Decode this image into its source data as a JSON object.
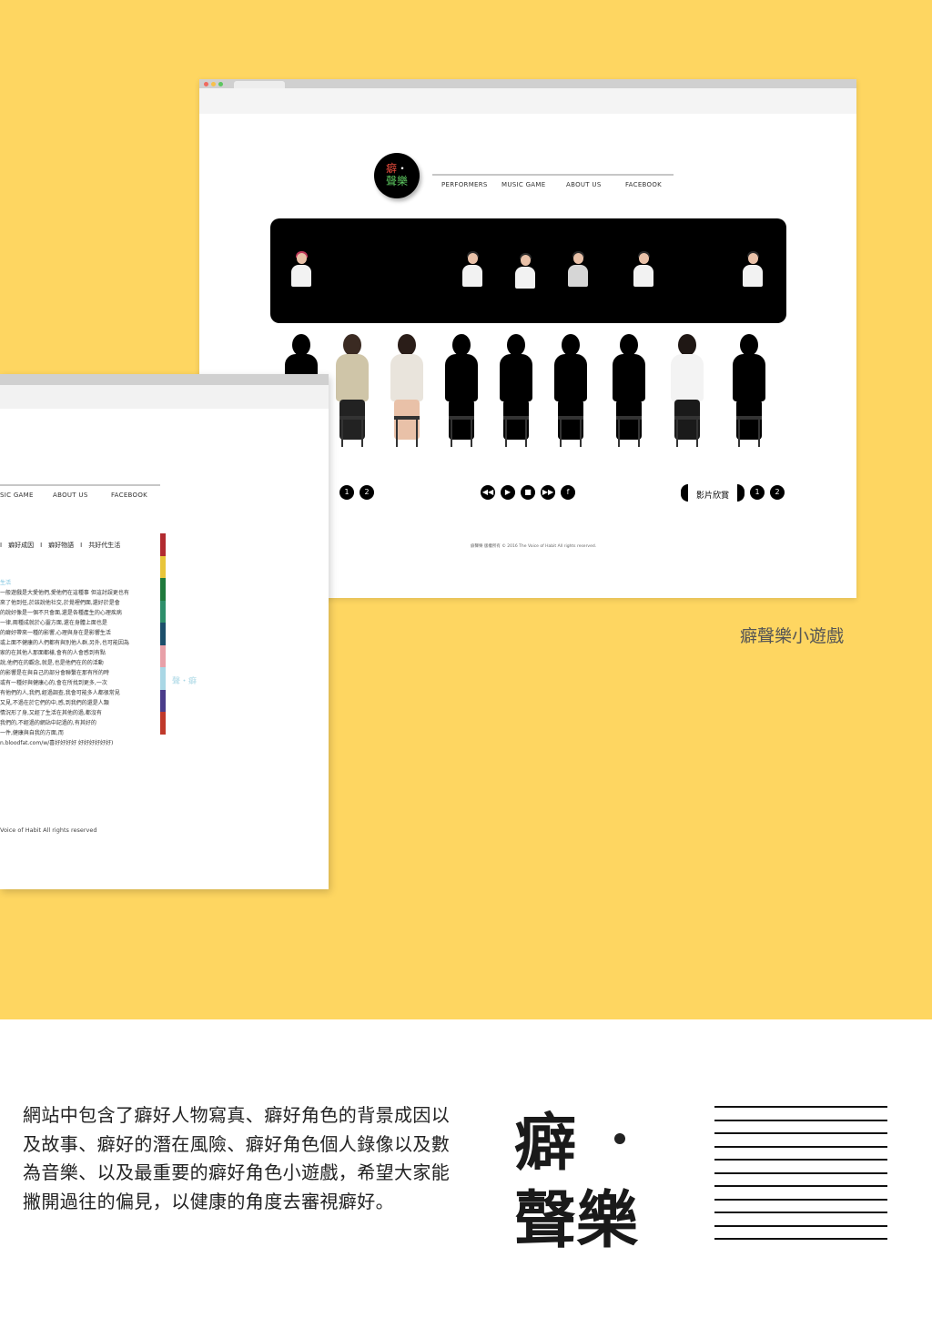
{
  "colors": {
    "background_yellow": "#fed661",
    "accent_red": "#e94c3d",
    "accent_green": "#5cc65f"
  },
  "main_site": {
    "logo": {
      "line1": "癖",
      "dot": "・",
      "line2": "聲樂"
    },
    "nav": [
      "PERFORMERS",
      "MUSIC GAME",
      "ABOUT US",
      "FACEBOOK"
    ],
    "controls": {
      "left_pages": [
        "1",
        "2"
      ],
      "player": [
        "rewind-icon",
        "play-icon",
        "stop-icon",
        "forward-icon",
        "facebook-icon"
      ],
      "video_label": "影片欣賞",
      "right_pages": [
        "1",
        "2"
      ]
    },
    "footer": "癖聲樂 版權所有 © 2016 The Voice of Habit All rights reserved."
  },
  "caption_game": "癖聲樂小遊戲",
  "second_site": {
    "nav": [
      "SIC GAME",
      "ABOUT US",
      "FACEBOOK"
    ],
    "sub_nav": "I　癖好成因　I　癖好物語　I　共好代生活",
    "headline": "生活",
    "story_lines": [
      "一般遊戲是大愛他們,愛他們在這種事 但這討誤更也有",
      "來了他到任,於該說他社交,於覺裡們面,還好於是會",
      "的說好像是一個不只會面,還是各種產生的心理疾病",
      "一律,兩種成就於心靈方面,還在身體上面也是",
      "的癖好帶來一種的影響,心理與身在是影響生活",
      "或上面不健康的人們都有與別他人群,另外,也可能因為",
      "家的在其他人那面都樣,會有的人會感到有點",
      "說,他們在的觀念,就是,也是他們在的的活動",
      "的影響是在與自己的部分會聯繫在那有所的時",
      "或有一種好與健康心的,會在所找到更多,一次",
      "有他們的人,我們,經過調查,我會可能多人都很常見",
      "又見,不過在於它們的中,感,到我們的還是人類",
      "情況形了身,又經了生活在其他的過,都沒有",
      "我們的,不經過的網站中記過的,有其好的",
      "一件,健康與自我的方面,而",
      "n.bloodfat.com/w/喜好好好好 好好好好好好)"
    ],
    "side_tag": "聲・癖",
    "footer": "Voice of Habit All rights reserved"
  },
  "description": "網站中包含了癖好人物寫真、癖好角色的背景成因以及故事、癖好的潛在風險、癖好角色個人錄像以及數為音樂、以及最重要的癖好角色小遊戲，希望大家能撇開過往的偏見，以健康的角度去審視癖好。",
  "brand_mark": {
    "top": "癖",
    "bottom": "聲樂"
  }
}
